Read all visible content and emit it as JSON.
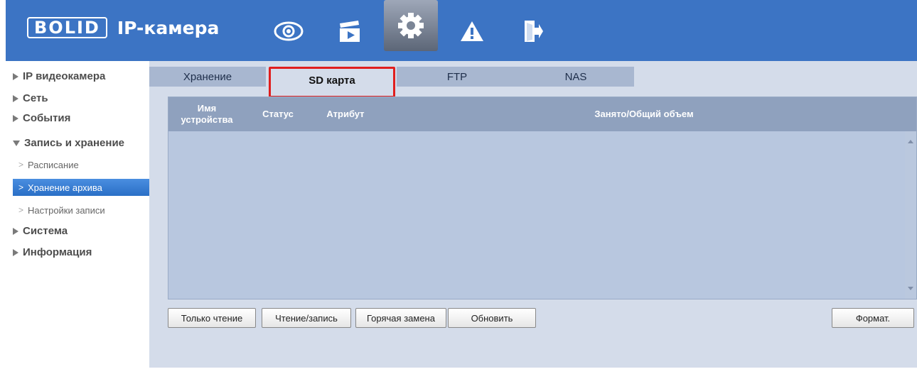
{
  "header": {
    "logo_text": "BOLID",
    "title": "IP-камера",
    "nav": [
      {
        "name": "live-view",
        "icon": "eye-icon"
      },
      {
        "name": "playback",
        "icon": "clapperboard-icon"
      },
      {
        "name": "settings",
        "icon": "gear-icon",
        "active": true
      },
      {
        "name": "alarm",
        "icon": "warning-icon"
      },
      {
        "name": "logout",
        "icon": "exit-icon"
      }
    ]
  },
  "sidebar": {
    "groups": [
      {
        "label": "IP видеокамера",
        "expanded": false
      },
      {
        "label": "Сеть",
        "expanded": false
      },
      {
        "label": "События",
        "expanded": false
      },
      {
        "label": "Запись и хранение",
        "expanded": true
      },
      {
        "label": "Система",
        "expanded": false
      },
      {
        "label": "Информация",
        "expanded": false
      }
    ],
    "sub_items": [
      {
        "label": "Расписание",
        "active": false
      },
      {
        "label": "Хранение архива",
        "active": true
      },
      {
        "label": "Настройки записи",
        "active": false
      }
    ]
  },
  "tabs": [
    {
      "label": "Хранение",
      "active": false
    },
    {
      "label": "SD карта",
      "active": true
    },
    {
      "label": "FTP",
      "active": false
    },
    {
      "label": "NAS",
      "active": false
    }
  ],
  "table": {
    "columns": [
      "Имя устройства",
      "Статус",
      "Атрибут",
      "Занято/Общий объем"
    ],
    "rows": []
  },
  "buttons": {
    "read_only": "Только чтение",
    "read_write": "Чтение/запись",
    "hot_swap": "Горячая замена",
    "refresh": "Обновить",
    "format": "Формат."
  },
  "colors": {
    "header_bg": "#3c74c4",
    "active_sidebar": "#2a6fc6",
    "tab_highlight": "#e01e1e"
  }
}
